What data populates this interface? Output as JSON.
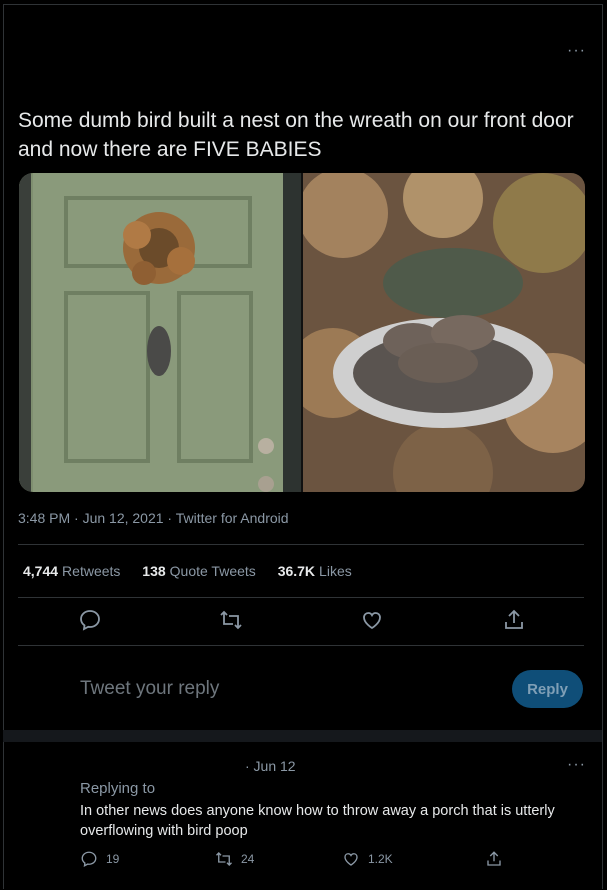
{
  "tweet": {
    "text": "Some dumb bird built a nest on the wreath on our front door and now there are FIVE BABIES",
    "more_label": "···",
    "meta": "3:48 PM · Jun 12, 2021 · Twitter for Android",
    "stats": {
      "retweets_count": "4,744",
      "retweets_label": "Retweets",
      "quotes_count": "138",
      "quotes_label": "Quote Tweets",
      "likes_count": "36.7K",
      "likes_label": "Likes"
    },
    "action_icons": [
      "reply-icon",
      "retweet-icon",
      "like-icon",
      "share-icon"
    ]
  },
  "compose": {
    "placeholder": "Tweet your reply",
    "button_label": "Reply"
  },
  "reply": {
    "date": "· Jun 12",
    "more_label": "···",
    "replying_to": "Replying to",
    "text": "In other news does anyone know how to throw away a porch that is utterly overflowing with bird poop",
    "reply_count": "19",
    "retweet_count": "24",
    "like_count": "1.2K"
  },
  "colors": {
    "background": "#000000",
    "text": "#e7e9ea",
    "muted": "#8b98a5",
    "divider": "#2f3336",
    "reply_button": "#0f4e78"
  }
}
